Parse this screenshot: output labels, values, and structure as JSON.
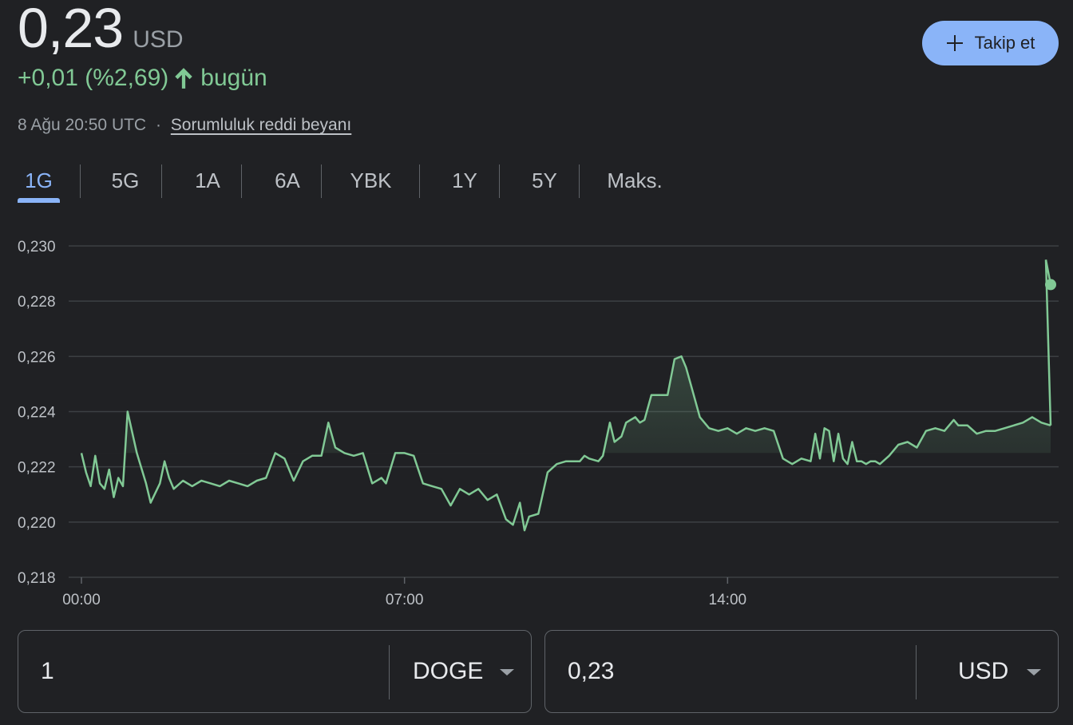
{
  "header": {
    "price": "0,23",
    "currency": "USD",
    "change": "+0,01 (%2,69)",
    "change_period": "bugün",
    "timestamp": "8 Ağu 20:50 UTC",
    "separator": "·",
    "disclaimer_link": "Sorumluluk reddi beyanı",
    "follow_button": "Takip et",
    "accent_color": "#8ab4f8",
    "positive_color": "#81c995"
  },
  "tabs": [
    {
      "label": "1G",
      "active": true
    },
    {
      "label": "5G"
    },
    {
      "label": "1A"
    },
    {
      "label": "6A"
    },
    {
      "label": "YBK"
    },
    {
      "label": "1Y"
    },
    {
      "label": "5Y"
    },
    {
      "label": "Maks."
    }
  ],
  "chart_data": {
    "type": "area",
    "title": "",
    "xlabel": "",
    "ylabel": "",
    "x_ticks": [
      "00:00",
      "07:00",
      "14:00"
    ],
    "y_ticks": [
      "0,218",
      "0,220",
      "0,222",
      "0,224",
      "0,226",
      "0,228",
      "0,230"
    ],
    "ylim": [
      0.218,
      0.23
    ],
    "xlim_hours": [
      0,
      21
    ],
    "grid": true,
    "line_color": "#81c995",
    "series": [
      {
        "points": [
          [
            0.0,
            0.2225
          ],
          [
            0.1,
            0.2218
          ],
          [
            0.2,
            0.2213
          ],
          [
            0.3,
            0.2224
          ],
          [
            0.4,
            0.2214
          ],
          [
            0.5,
            0.2212
          ],
          [
            0.6,
            0.2219
          ],
          [
            0.7,
            0.2209
          ],
          [
            0.8,
            0.2216
          ],
          [
            0.9,
            0.2213
          ],
          [
            1.0,
            0.224
          ],
          [
            1.2,
            0.2225
          ],
          [
            1.4,
            0.2214
          ],
          [
            1.5,
            0.2207
          ],
          [
            1.7,
            0.2214
          ],
          [
            1.8,
            0.2222
          ],
          [
            1.9,
            0.2216
          ],
          [
            2.0,
            0.2212
          ],
          [
            2.2,
            0.2215
          ],
          [
            2.4,
            0.2213
          ],
          [
            2.6,
            0.2215
          ],
          [
            2.8,
            0.2214
          ],
          [
            3.0,
            0.2213
          ],
          [
            3.2,
            0.2215
          ],
          [
            3.4,
            0.2214
          ],
          [
            3.6,
            0.2213
          ],
          [
            3.8,
            0.2215
          ],
          [
            4.0,
            0.2216
          ],
          [
            4.2,
            0.2225
          ],
          [
            4.4,
            0.2223
          ],
          [
            4.6,
            0.2215
          ],
          [
            4.8,
            0.2222
          ],
          [
            5.0,
            0.2224
          ],
          [
            5.2,
            0.2224
          ],
          [
            5.35,
            0.2236
          ],
          [
            5.5,
            0.2227
          ],
          [
            5.7,
            0.2225
          ],
          [
            5.9,
            0.2224
          ],
          [
            6.1,
            0.2225
          ],
          [
            6.3,
            0.2214
          ],
          [
            6.5,
            0.2216
          ],
          [
            6.6,
            0.2214
          ],
          [
            6.8,
            0.2225
          ],
          [
            7.0,
            0.2225
          ],
          [
            7.2,
            0.2224
          ],
          [
            7.4,
            0.2214
          ],
          [
            7.6,
            0.2213
          ],
          [
            7.8,
            0.2212
          ],
          [
            8.0,
            0.2206
          ],
          [
            8.2,
            0.2212
          ],
          [
            8.4,
            0.221
          ],
          [
            8.6,
            0.2212
          ],
          [
            8.8,
            0.2208
          ],
          [
            9.0,
            0.221
          ],
          [
            9.2,
            0.2201
          ],
          [
            9.35,
            0.2199
          ],
          [
            9.5,
            0.2207
          ],
          [
            9.6,
            0.2197
          ],
          [
            9.7,
            0.2202
          ],
          [
            9.9,
            0.2203
          ],
          [
            10.1,
            0.2218
          ],
          [
            10.3,
            0.2221
          ],
          [
            10.5,
            0.2222
          ],
          [
            10.6,
            0.2222
          ],
          [
            10.8,
            0.2222
          ],
          [
            10.9,
            0.2224
          ],
          [
            11.0,
            0.2223
          ],
          [
            11.2,
            0.2222
          ],
          [
            11.3,
            0.2224
          ],
          [
            11.45,
            0.2236
          ],
          [
            11.55,
            0.2229
          ],
          [
            11.7,
            0.2231
          ],
          [
            11.8,
            0.2236
          ],
          [
            12.0,
            0.2238
          ],
          [
            12.1,
            0.2236
          ],
          [
            12.2,
            0.2237
          ],
          [
            12.35,
            0.2246
          ],
          [
            12.5,
            0.2246
          ],
          [
            12.7,
            0.2246
          ],
          [
            12.85,
            0.2259
          ],
          [
            13.0,
            0.226
          ],
          [
            13.1,
            0.2256
          ],
          [
            13.2,
            0.225
          ],
          [
            13.4,
            0.2238
          ],
          [
            13.6,
            0.2234
          ],
          [
            13.8,
            0.2233
          ],
          [
            14.0,
            0.2234
          ],
          [
            14.2,
            0.2232
          ],
          [
            14.4,
            0.2234
          ],
          [
            14.6,
            0.2233
          ],
          [
            14.8,
            0.2234
          ],
          [
            15.0,
            0.2233
          ],
          [
            15.2,
            0.2223
          ],
          [
            15.4,
            0.2221
          ],
          [
            15.6,
            0.2223
          ],
          [
            15.8,
            0.2222
          ],
          [
            15.9,
            0.2232
          ],
          [
            16.0,
            0.2223
          ],
          [
            16.1,
            0.2234
          ],
          [
            16.2,
            0.2233
          ],
          [
            16.3,
            0.2222
          ],
          [
            16.4,
            0.2232
          ],
          [
            16.5,
            0.2223
          ],
          [
            16.6,
            0.2221
          ],
          [
            16.7,
            0.2229
          ],
          [
            16.8,
            0.2222
          ],
          [
            16.9,
            0.2222
          ],
          [
            17.0,
            0.2221
          ],
          [
            17.1,
            0.2222
          ],
          [
            17.2,
            0.2222
          ],
          [
            17.3,
            0.2221
          ],
          [
            17.5,
            0.2224
          ],
          [
            17.7,
            0.2228
          ],
          [
            17.9,
            0.2229
          ],
          [
            18.1,
            0.2227
          ],
          [
            18.3,
            0.2233
          ],
          [
            18.5,
            0.2234
          ],
          [
            18.7,
            0.2233
          ],
          [
            18.9,
            0.2237
          ],
          [
            19.0,
            0.2235
          ],
          [
            19.2,
            0.2235
          ],
          [
            19.4,
            0.2232
          ],
          [
            19.6,
            0.2233
          ],
          [
            19.8,
            0.2233
          ],
          [
            20.0,
            0.2234
          ],
          [
            20.2,
            0.2235
          ],
          [
            20.4,
            0.2236
          ],
          [
            20.6,
            0.2238
          ],
          [
            20.8,
            0.2236
          ],
          [
            21.0,
            0.2235
          ]
        ]
      }
    ],
    "last_value": 0.2286
  },
  "converter": {
    "from_amount": "1",
    "from_currency": "DOGE",
    "to_amount": "0,23",
    "to_currency": "USD"
  }
}
